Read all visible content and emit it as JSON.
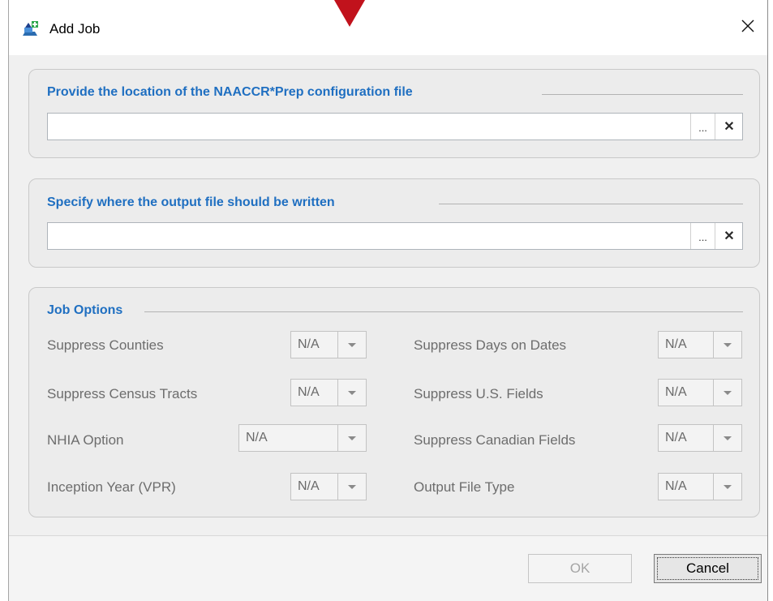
{
  "window": {
    "title": "Add Job",
    "close_symbol": "✕"
  },
  "config_section": {
    "title": "Provide the location of the NAACCR*Prep configuration file",
    "value": "",
    "browse_label": "...",
    "clear_label": "✕"
  },
  "output_section": {
    "title": "Specify where the output file should be written",
    "value": "",
    "browse_label": "...",
    "clear_label": "✕"
  },
  "job_options": {
    "title": "Job Options",
    "options": [
      {
        "label": "Suppress Counties",
        "value": "N/A"
      },
      {
        "label": "Suppress Census Tracts",
        "value": "N/A"
      },
      {
        "label": "NHIA Option",
        "value": "N/A"
      },
      {
        "label": "Inception Year (VPR)",
        "value": "N/A"
      },
      {
        "label": "Suppress Days on Dates",
        "value": "N/A"
      },
      {
        "label": "Suppress U.S. Fields",
        "value": "N/A"
      },
      {
        "label": "Suppress Canadian Fields",
        "value": "N/A"
      },
      {
        "label": "Output File Type",
        "value": "N/A"
      }
    ]
  },
  "footer": {
    "ok_label": "OK",
    "cancel_label": "Cancel"
  },
  "colors": {
    "accent": "#1f6fc1",
    "pointer": "#c1121c"
  }
}
